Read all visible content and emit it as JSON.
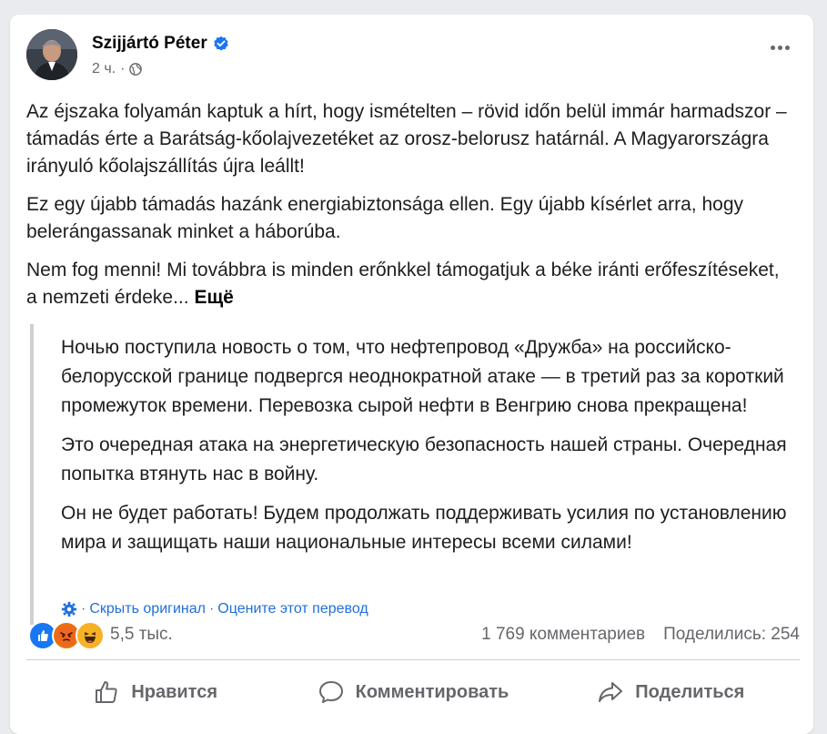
{
  "post": {
    "author": "Szijjártó Péter",
    "time": "2 ч.",
    "dot": "·",
    "paragraphs": [
      "Az éjszaka folyamán kaptuk a hírt, hogy ismételten – rövid időn belül immár harmadszor – támadás érte a Barátság-kőolajvezetéket az orosz-belorusz határnál. A Magyarországra irányuló kőolajszállítás újra leállt!",
      "Ez egy újabb támadás hazánk energiabiztonsága ellen. Egy újabb kísérlet arra, hogy belerángassanak minket a háborúba."
    ],
    "last_paragraph": "Nem fog menni! Mi továbbra is minden erőnkkel támogatjuk a béke iránti erőfeszítéseket, a nemzeti érdeke...",
    "see_more": "Ещё"
  },
  "translation": {
    "paragraphs": [
      "Ночью поступила новость о том, что нефтепровод «Дружба» на российско-белорусской границе подвергся неоднократной атаке — в третий раз за короткий промежуток времени. Перевозка сырой нефти в Венгрию снова прекращена!",
      "Это очередная атака на энергетическую безопасность нашей страны. Очередная попытка втянуть нас в войну.",
      "Он не будет работать! Будем продолжать поддерживать усилия по установлению мира и защищать наши национальные интересы всеми силами!"
    ],
    "hide_original": "Скрыть оригинал",
    "rate_translation": "Оцените этот перевод",
    "separator": "·"
  },
  "stats": {
    "reactions_count": "5,5 тыс.",
    "comments": "1 769 комментариев",
    "shares": "Поделились: 254"
  },
  "actions": {
    "like": "Нравится",
    "comment": "Комментировать",
    "share": "Поделиться"
  },
  "colors": {
    "link": "#216fdb",
    "secondary_text": "#65676b",
    "like_blue": "#1877f2",
    "angry_orange": "#e9710f",
    "haha_yellow": "#f7b125"
  }
}
